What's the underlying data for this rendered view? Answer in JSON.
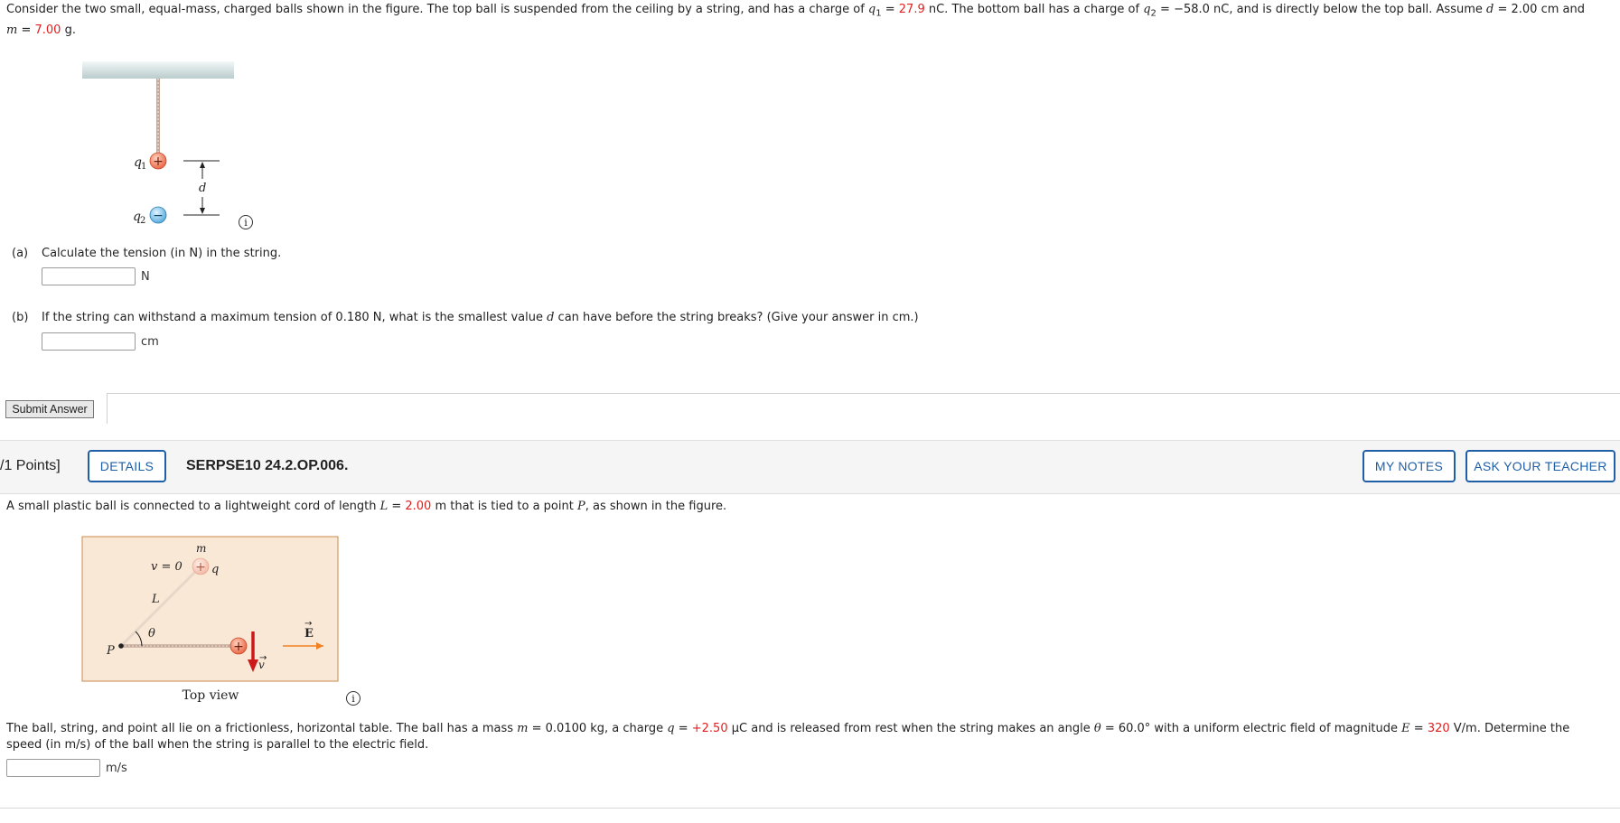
{
  "problem1": {
    "intro": {
      "p1": "Consider the two small, equal-mass, charged balls shown in the figure. The top ball is suspended from the ceiling by a string, and has a charge of ",
      "q1_sym": "q",
      "q1_sub": "1",
      "eq1": " = ",
      "q1_val": "27.9",
      "p2": " nC. The bottom ball has a charge of ",
      "q2_sym": "q",
      "q2_sub": "2",
      "p3": " = −58.0 nC, and is directly below the top ball. Assume ",
      "d_sym": "d",
      "p4": " = 2.00 cm and",
      "m_sym": "m",
      "eq2": " = ",
      "m_val": "7.00",
      "p5": " g."
    },
    "figure": {
      "q1_label": "q",
      "q1_sub": "1",
      "q2_label": "q",
      "q2_sub": "2",
      "d_label": "d",
      "plus_sign": "+",
      "minus_sign": "−"
    },
    "part_a": {
      "tag": "(a)",
      "text": "Calculate the tension (in N) in the string.",
      "unit": "N"
    },
    "part_b": {
      "tag": "(b)",
      "text_1": "If the string can withstand a maximum tension of 0.180 N, what is the smallest value ",
      "d_sym": "d",
      "text_2": " can have before the string breaks? (Give your answer in cm.)",
      "unit": "cm"
    },
    "submit_label": "Submit Answer",
    "info_glyph": "i"
  },
  "problem2": {
    "points": "/1 Points]",
    "details_label": "DETAILS",
    "question_id": "SERPSE10 24.2.OP.006.",
    "my_notes_label": "MY NOTES",
    "ask_teacher_label": "ASK YOUR TEACHER",
    "intro": {
      "p1": "A small plastic ball is connected to a lightweight cord of length ",
      "L_sym": "L",
      "eq": " = ",
      "L_val": "2.00",
      "p2": " m that is tied to a point ",
      "P_sym": "P",
      "p3": ", as shown in the figure."
    },
    "figure": {
      "m_label": "m",
      "v0_label": "v = 0",
      "q_label": "q",
      "L_label": "L",
      "theta_label": "θ",
      "P_label": "P",
      "E_label": "E",
      "v_label": "v",
      "caption": "Top view",
      "plus_sign": "+",
      "background": "#fae8d6",
      "border": "#c98a4a"
    },
    "body": {
      "t1": "The ball, string, and point all lie on a frictionless, horizontal table. The ball has a mass ",
      "m_sym": "m",
      "t2": " = 0.0100 kg, a charge ",
      "q_sym": "q",
      "t3": " = ",
      "q_val": "+2.50",
      "t4": " μC and is released from rest when the string makes an angle ",
      "theta_sym": "θ",
      "t5": " = 60.0° with a uniform electric field of magnitude ",
      "E_sym": "E",
      "t6": " = ",
      "E_val": "320",
      "t7": " V/m. Determine the",
      "t8": "speed (in m/s) of the ball when the string is parallel to the electric field."
    },
    "unit": "m/s",
    "info_glyph": "i"
  },
  "colors": {
    "accent_blue": "#1e5fa8",
    "value_red": "#e02020"
  }
}
